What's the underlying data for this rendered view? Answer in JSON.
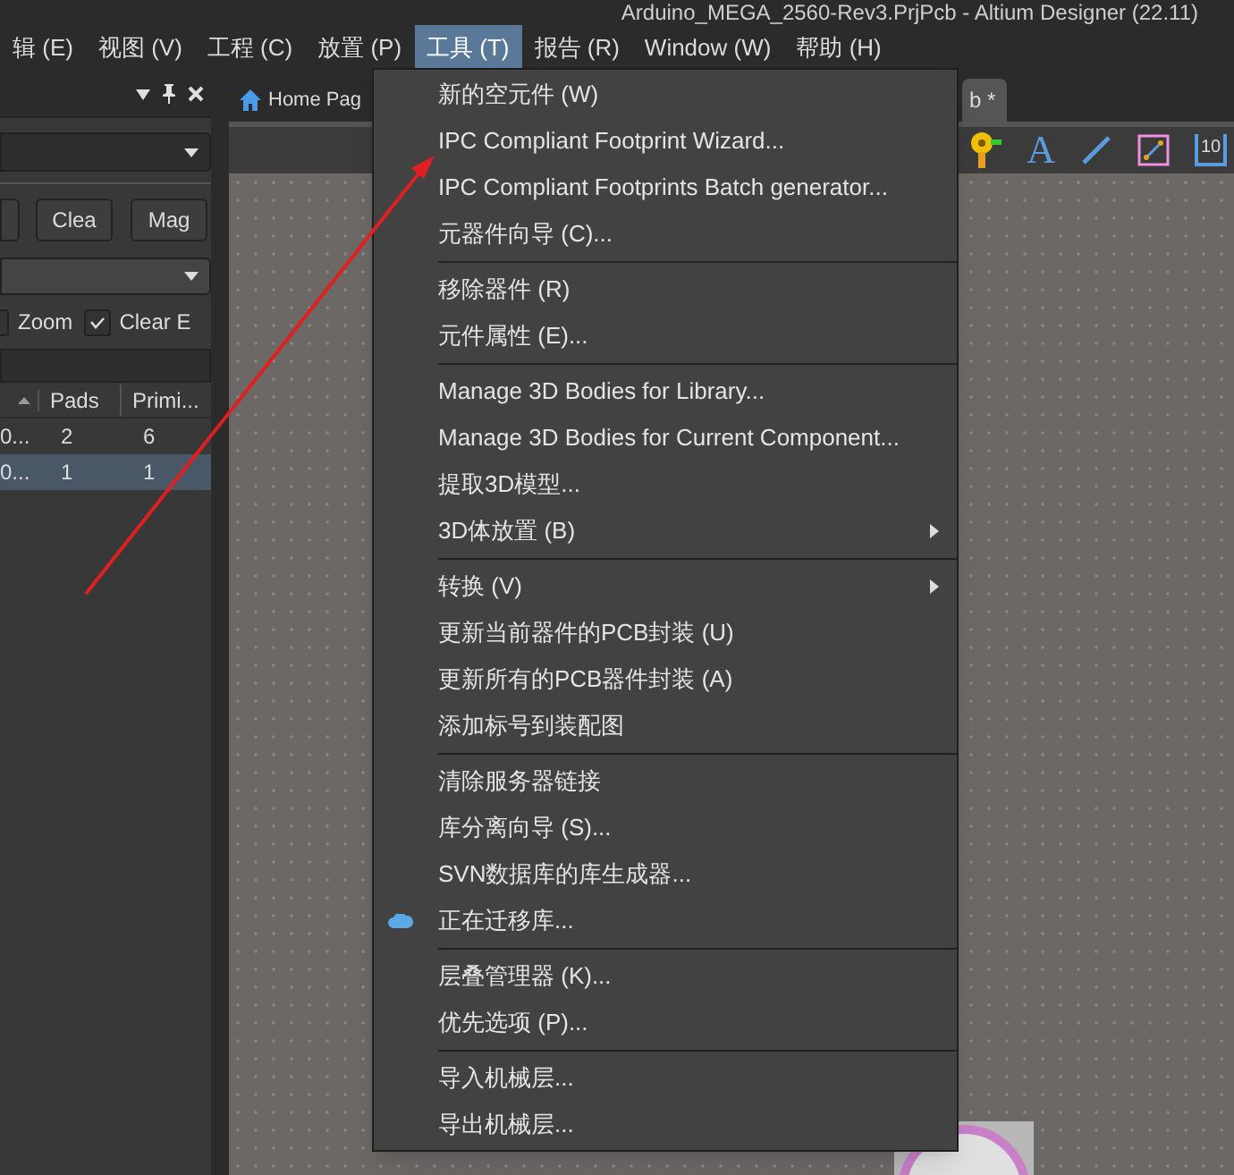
{
  "window": {
    "title": "Arduino_MEGA_2560-Rev3.PrjPcb - Altium Designer (22.11)"
  },
  "menu_bar": {
    "items": [
      {
        "label": "辑 (E)",
        "selected": false
      },
      {
        "label": "视图 (V)",
        "selected": false
      },
      {
        "label": "工程 (C)",
        "selected": false
      },
      {
        "label": "放置 (P)",
        "selected": false
      },
      {
        "label": "工具 (T)",
        "selected": true
      },
      {
        "label": "报告 (R)",
        "selected": false
      },
      {
        "label": "Window (W)",
        "selected": false
      },
      {
        "label": "帮助 (H)",
        "selected": false
      }
    ]
  },
  "left_panel": {
    "buttons": [
      "Clea",
      "Mag"
    ],
    "checks": [
      {
        "label": "Zoom",
        "checked": false
      },
      {
        "label": "Clear E",
        "checked": true
      }
    ],
    "table": {
      "columns": [
        "",
        "Pads",
        "Primi..."
      ],
      "rows": [
        {
          "cells": [
            "0...",
            "2",
            "6"
          ],
          "selected": false
        },
        {
          "cells": [
            "0...",
            "1",
            "1"
          ],
          "selected": true
        }
      ]
    }
  },
  "tabs": [
    {
      "label": "Home Pag",
      "selected": false
    },
    {
      "label": "b *",
      "selected": true
    }
  ],
  "toolbar": {
    "text_glyph": "A",
    "counter_glyph": "10"
  },
  "menu": {
    "items": [
      {
        "kind": "item",
        "label": "新的空元件 (W)",
        "submenu": false,
        "has_icon": false
      },
      {
        "kind": "item",
        "label": "IPC Compliant Footprint Wizard...",
        "submenu": false,
        "has_icon": false
      },
      {
        "kind": "item",
        "label": "IPC Compliant Footprints Batch generator...",
        "submenu": false,
        "has_icon": false
      },
      {
        "kind": "item",
        "label": "元器件向导 (C)...",
        "submenu": false,
        "has_icon": false
      },
      {
        "kind": "separator"
      },
      {
        "kind": "item",
        "label": "移除器件 (R)",
        "submenu": false,
        "has_icon": false
      },
      {
        "kind": "item",
        "label": "元件属性 (E)...",
        "submenu": false,
        "has_icon": false
      },
      {
        "kind": "separator"
      },
      {
        "kind": "item",
        "label": "Manage 3D Bodies for Library...",
        "submenu": false,
        "has_icon": false
      },
      {
        "kind": "item",
        "label": "Manage 3D Bodies for Current Component...",
        "submenu": false,
        "has_icon": false
      },
      {
        "kind": "item",
        "label": "提取3D模型...",
        "submenu": false,
        "has_icon": false
      },
      {
        "kind": "item",
        "label": "3D体放置 (B)",
        "submenu": true,
        "has_icon": false
      },
      {
        "kind": "separator"
      },
      {
        "kind": "item",
        "label": "转换 (V)",
        "submenu": true,
        "has_icon": false
      },
      {
        "kind": "item",
        "label": "更新当前器件的PCB封装 (U)",
        "submenu": false,
        "has_icon": false
      },
      {
        "kind": "item",
        "label": "更新所有的PCB器件封装 (A)",
        "submenu": false,
        "has_icon": false
      },
      {
        "kind": "item",
        "label": "添加标号到装配图",
        "submenu": false,
        "has_icon": false
      },
      {
        "kind": "separator"
      },
      {
        "kind": "item",
        "label": "清除服务器链接",
        "submenu": false,
        "has_icon": false
      },
      {
        "kind": "item",
        "label": "库分离向导 (S)...",
        "submenu": false,
        "has_icon": false
      },
      {
        "kind": "item",
        "label": "SVN数据库的库生成器...",
        "submenu": false,
        "has_icon": false
      },
      {
        "kind": "item",
        "label": "正在迁移库...",
        "submenu": false,
        "has_icon": true
      },
      {
        "kind": "separator"
      },
      {
        "kind": "item",
        "label": "层叠管理器 (K)...",
        "submenu": false,
        "has_icon": false
      },
      {
        "kind": "item",
        "label": "优先选项 (P)...",
        "submenu": false,
        "has_icon": false
      },
      {
        "kind": "separator"
      },
      {
        "kind": "item",
        "label": "导入机械层...",
        "submenu": false,
        "has_icon": false
      },
      {
        "kind": "item",
        "label": "导出机械层...",
        "submenu": false,
        "has_icon": false
      }
    ]
  }
}
